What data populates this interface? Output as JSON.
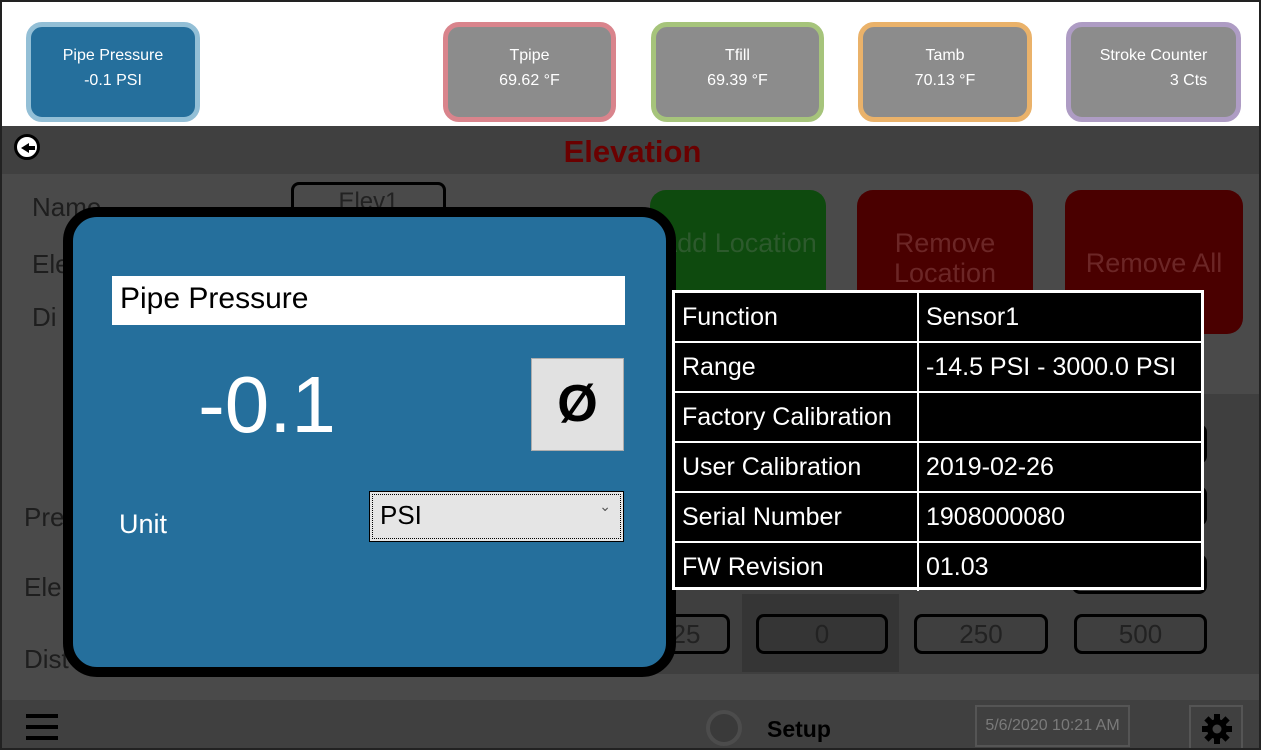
{
  "sensor_tiles": [
    {
      "name": "Pipe Pressure",
      "value": "-0.1 PSI"
    },
    {
      "name": "Tpipe",
      "value": "69.62 °F"
    },
    {
      "name": "Tfill",
      "value": "69.39 °F"
    },
    {
      "name": "Tamb",
      "value": "70.13 °F"
    },
    {
      "name": "Stroke Counter",
      "value": "3 Cts"
    }
  ],
  "header": {
    "title": "Elevation"
  },
  "background": {
    "name_label": "Name",
    "elevation_label": "Ele",
    "distance_label": "Di",
    "name_value": "Elev1",
    "pressure_label": "Pre",
    "elevation_row_label": "Ele",
    "distance_row_label": "Dist",
    "buttons": {
      "add": "Add Location",
      "remove": "Remove Location",
      "remove_all": "Remove All"
    },
    "distance_values": [
      "25",
      "0",
      "250",
      "500"
    ]
  },
  "dialog": {
    "title": "Pipe Pressure",
    "value": "-0.1",
    "zero_symbol": "Ø",
    "unit_label": "Unit",
    "unit_value": "PSI"
  },
  "info_table": [
    {
      "key": "Function",
      "value": "Sensor1"
    },
    {
      "key": "Range",
      "value": " -14.5 PSI - 3000.0 PSI"
    },
    {
      "key": "Factory Calibration",
      "value": ""
    },
    {
      "key": "User Calibration",
      "value": "2019-02-26"
    },
    {
      "key": "Serial Number",
      "value": "1908000080"
    },
    {
      "key": "FW Revision",
      "value": "01.03"
    }
  ],
  "footer": {
    "setup_label": "Setup",
    "datetime": "5/6/2020 10:21 AM"
  },
  "icons": {
    "back": "back-arrow-icon",
    "menu": "menu-icon",
    "settings": "gear-icon"
  }
}
